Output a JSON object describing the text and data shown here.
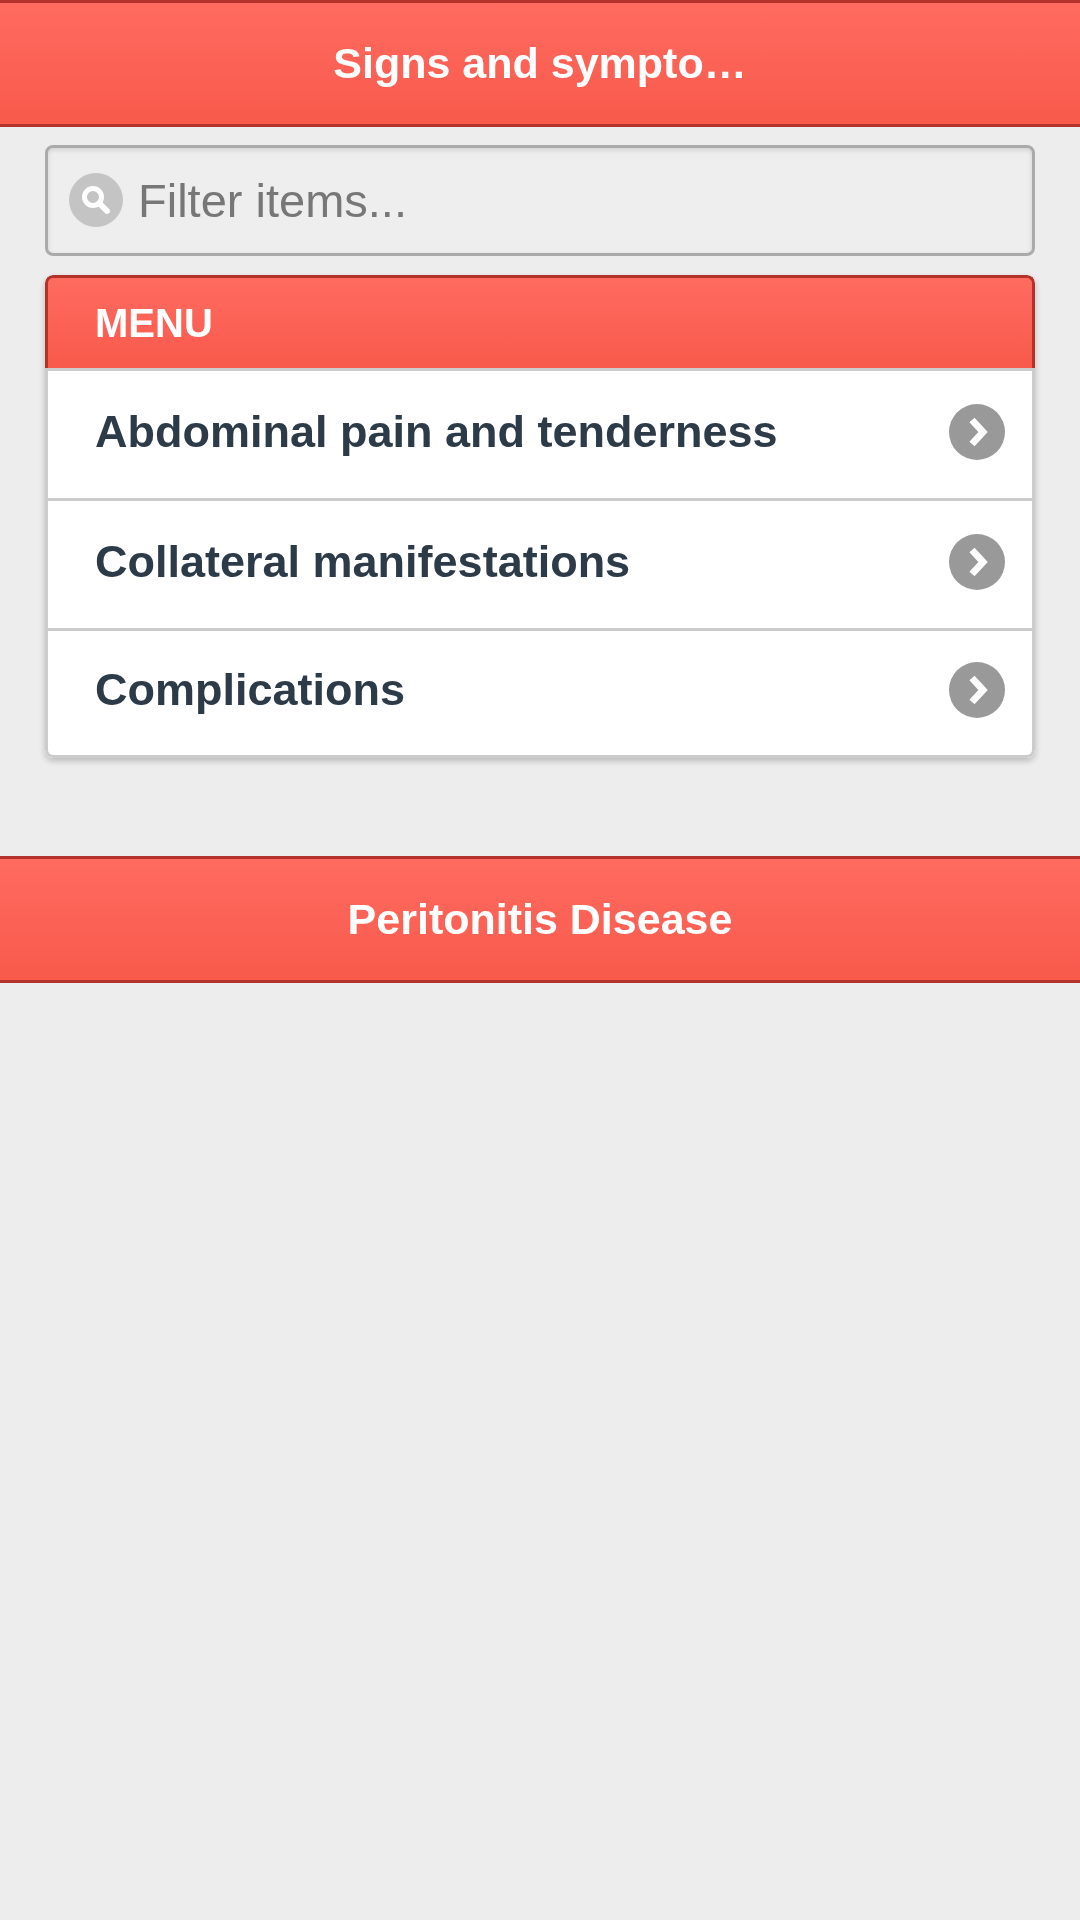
{
  "header": {
    "title": "Signs and sympto…"
  },
  "search": {
    "placeholder": "Filter items..."
  },
  "menu": {
    "title": "MENU",
    "items": [
      {
        "label": "Abdominal pain and tenderness"
      },
      {
        "label": "Collateral manifestations"
      },
      {
        "label": "Complications"
      }
    ]
  },
  "footer": {
    "title": "Peritonitis Disease"
  }
}
